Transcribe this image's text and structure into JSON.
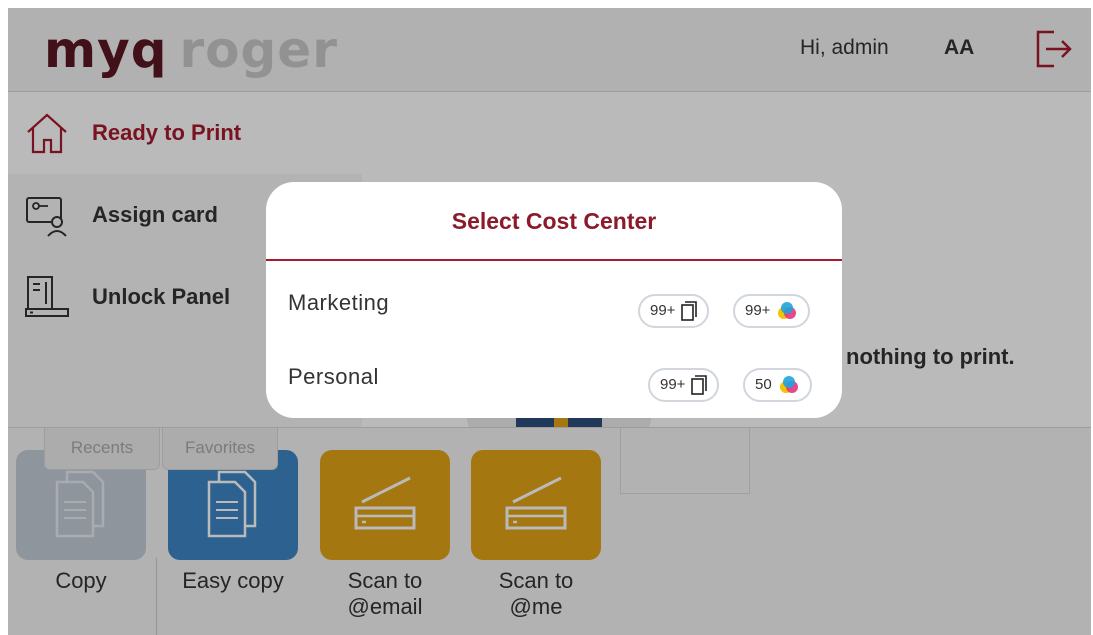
{
  "header": {
    "logo_primary": "myq",
    "logo_secondary": "roger",
    "greeting": "Hi, admin",
    "initials": "AA"
  },
  "sidebar": {
    "items": [
      {
        "label": "Ready to Print",
        "icon": "home-icon",
        "active": true
      },
      {
        "label": "Assign card",
        "icon": "id-card-icon",
        "active": false
      },
      {
        "label": "Unlock Panel",
        "icon": "printer-panel-icon",
        "active": false
      }
    ]
  },
  "main": {
    "empty_message": "nothing to print."
  },
  "bottom": {
    "tabs": [
      "Recents",
      "Favorites"
    ],
    "tiles": [
      {
        "label": "Copy",
        "icon": "copy-icon",
        "color": "#c5cdd8"
      },
      {
        "label": "Easy copy",
        "icon": "copy-icon",
        "color": "#3d86c6"
      },
      {
        "label_line1": "Scan to",
        "label_line2": "@email",
        "icon": "scanner-icon",
        "color": "#e3a418"
      },
      {
        "label_line1": "Scan to",
        "label_line2": "@me",
        "icon": "scanner-icon",
        "color": "#e3a418"
      }
    ]
  },
  "modal": {
    "title": "Select Cost Center",
    "cost_centers": [
      {
        "name": "Marketing",
        "mono_count": "99+",
        "color_count": "99+"
      },
      {
        "name": "Personal",
        "mono_count": "99+",
        "color_count": "50"
      }
    ]
  },
  "colors": {
    "brand": "#a6192e",
    "brand_dark": "#5a1722",
    "scan_tile": "#e3a418",
    "easy_copy_tile": "#3d86c6"
  }
}
